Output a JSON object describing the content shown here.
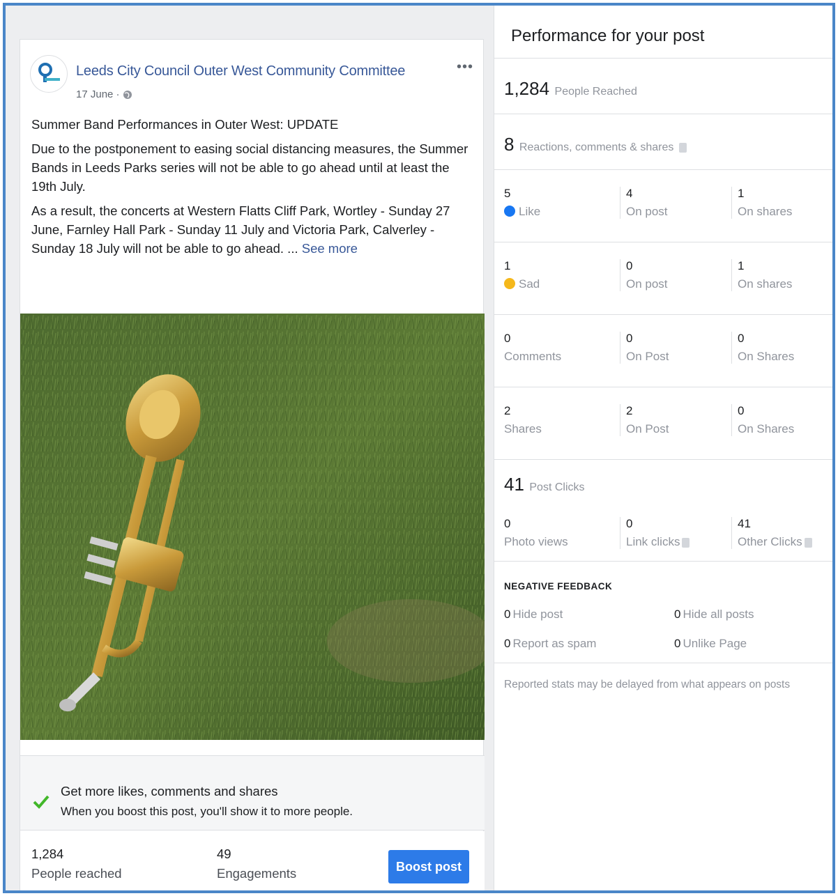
{
  "post": {
    "page_name": "Leeds City Council Outer West Community Committee",
    "date": "17 June ·",
    "title_line": "Summer Band Performances in Outer West: UPDATE",
    "paragraph1": "Due to the postponement to easing social distancing measures, the Summer Bands in Leeds Parks series will not be able to go ahead until at least the 19th July.",
    "paragraph2": "As a result, the concerts at Western Flatts Cliff Park, Wortley - Sunday 27 June, Farnley Hall Park - Sunday 11 July and Victoria Park, Calverley - Sunday 18 July will not be able to go ahead. ...",
    "see_more": "See more",
    "more_icon": "•••"
  },
  "boost_tip": {
    "title": "Get more likes, comments and shares",
    "subtitle": "When you boost this post, you'll show it to more people."
  },
  "post_stats": {
    "reached_value": "1,284",
    "reached_label": "People reached",
    "engagements_value": "49",
    "engagements_label": "Engagements",
    "boost_button": "Boost post"
  },
  "performance": {
    "title": "Performance for your post",
    "people_reached": {
      "value": "1,284",
      "label": "People Reached"
    },
    "reactions": {
      "value": "8",
      "label": "Reactions, comments & shares"
    },
    "rows": [
      {
        "c1_value": "5",
        "c1_label": "Like",
        "c2_value": "4",
        "c2_label": "On post",
        "c3_value": "1",
        "c3_label": "On shares"
      },
      {
        "c1_value": "1",
        "c1_label": "Sad",
        "c2_value": "0",
        "c2_label": "On post",
        "c3_value": "1",
        "c3_label": "On shares"
      },
      {
        "c1_value": "0",
        "c1_label": "Comments",
        "c2_value": "0",
        "c2_label": "On Post",
        "c3_value": "0",
        "c3_label": "On Shares"
      },
      {
        "c1_value": "2",
        "c1_label": "Shares",
        "c2_value": "2",
        "c2_label": "On Post",
        "c3_value": "0",
        "c3_label": "On Shares"
      }
    ],
    "post_clicks": {
      "value": "41",
      "label": "Post Clicks"
    },
    "clicks": [
      {
        "value": "0",
        "label": "Photo views"
      },
      {
        "value": "0",
        "label": "Link clicks"
      },
      {
        "value": "41",
        "label": "Other Clicks"
      }
    ],
    "negative_feedback": {
      "title": "NEGATIVE FEEDBACK",
      "hide_post": {
        "value": "0",
        "label": "Hide post"
      },
      "hide_all": {
        "value": "0",
        "label": "Hide all posts"
      },
      "report_spam": {
        "value": "0",
        "label": "Report as spam"
      },
      "unlike_page": {
        "value": "0",
        "label": "Unlike Page"
      }
    },
    "disclaimer": "Reported stats may be delayed from what appears on posts"
  },
  "colors": {
    "frame_border": "#4a86c8",
    "link_blue": "#385898",
    "boost_button": "#2d7be8",
    "like_blue": "#1877f2",
    "sad_yellow": "#f5b81b",
    "check_green": "#42b72a"
  },
  "icons": [
    "page-logo-icon",
    "globe-icon",
    "more-options-icon",
    "check-icon",
    "like-reaction-icon",
    "sad-reaction-icon",
    "info-icon"
  ]
}
